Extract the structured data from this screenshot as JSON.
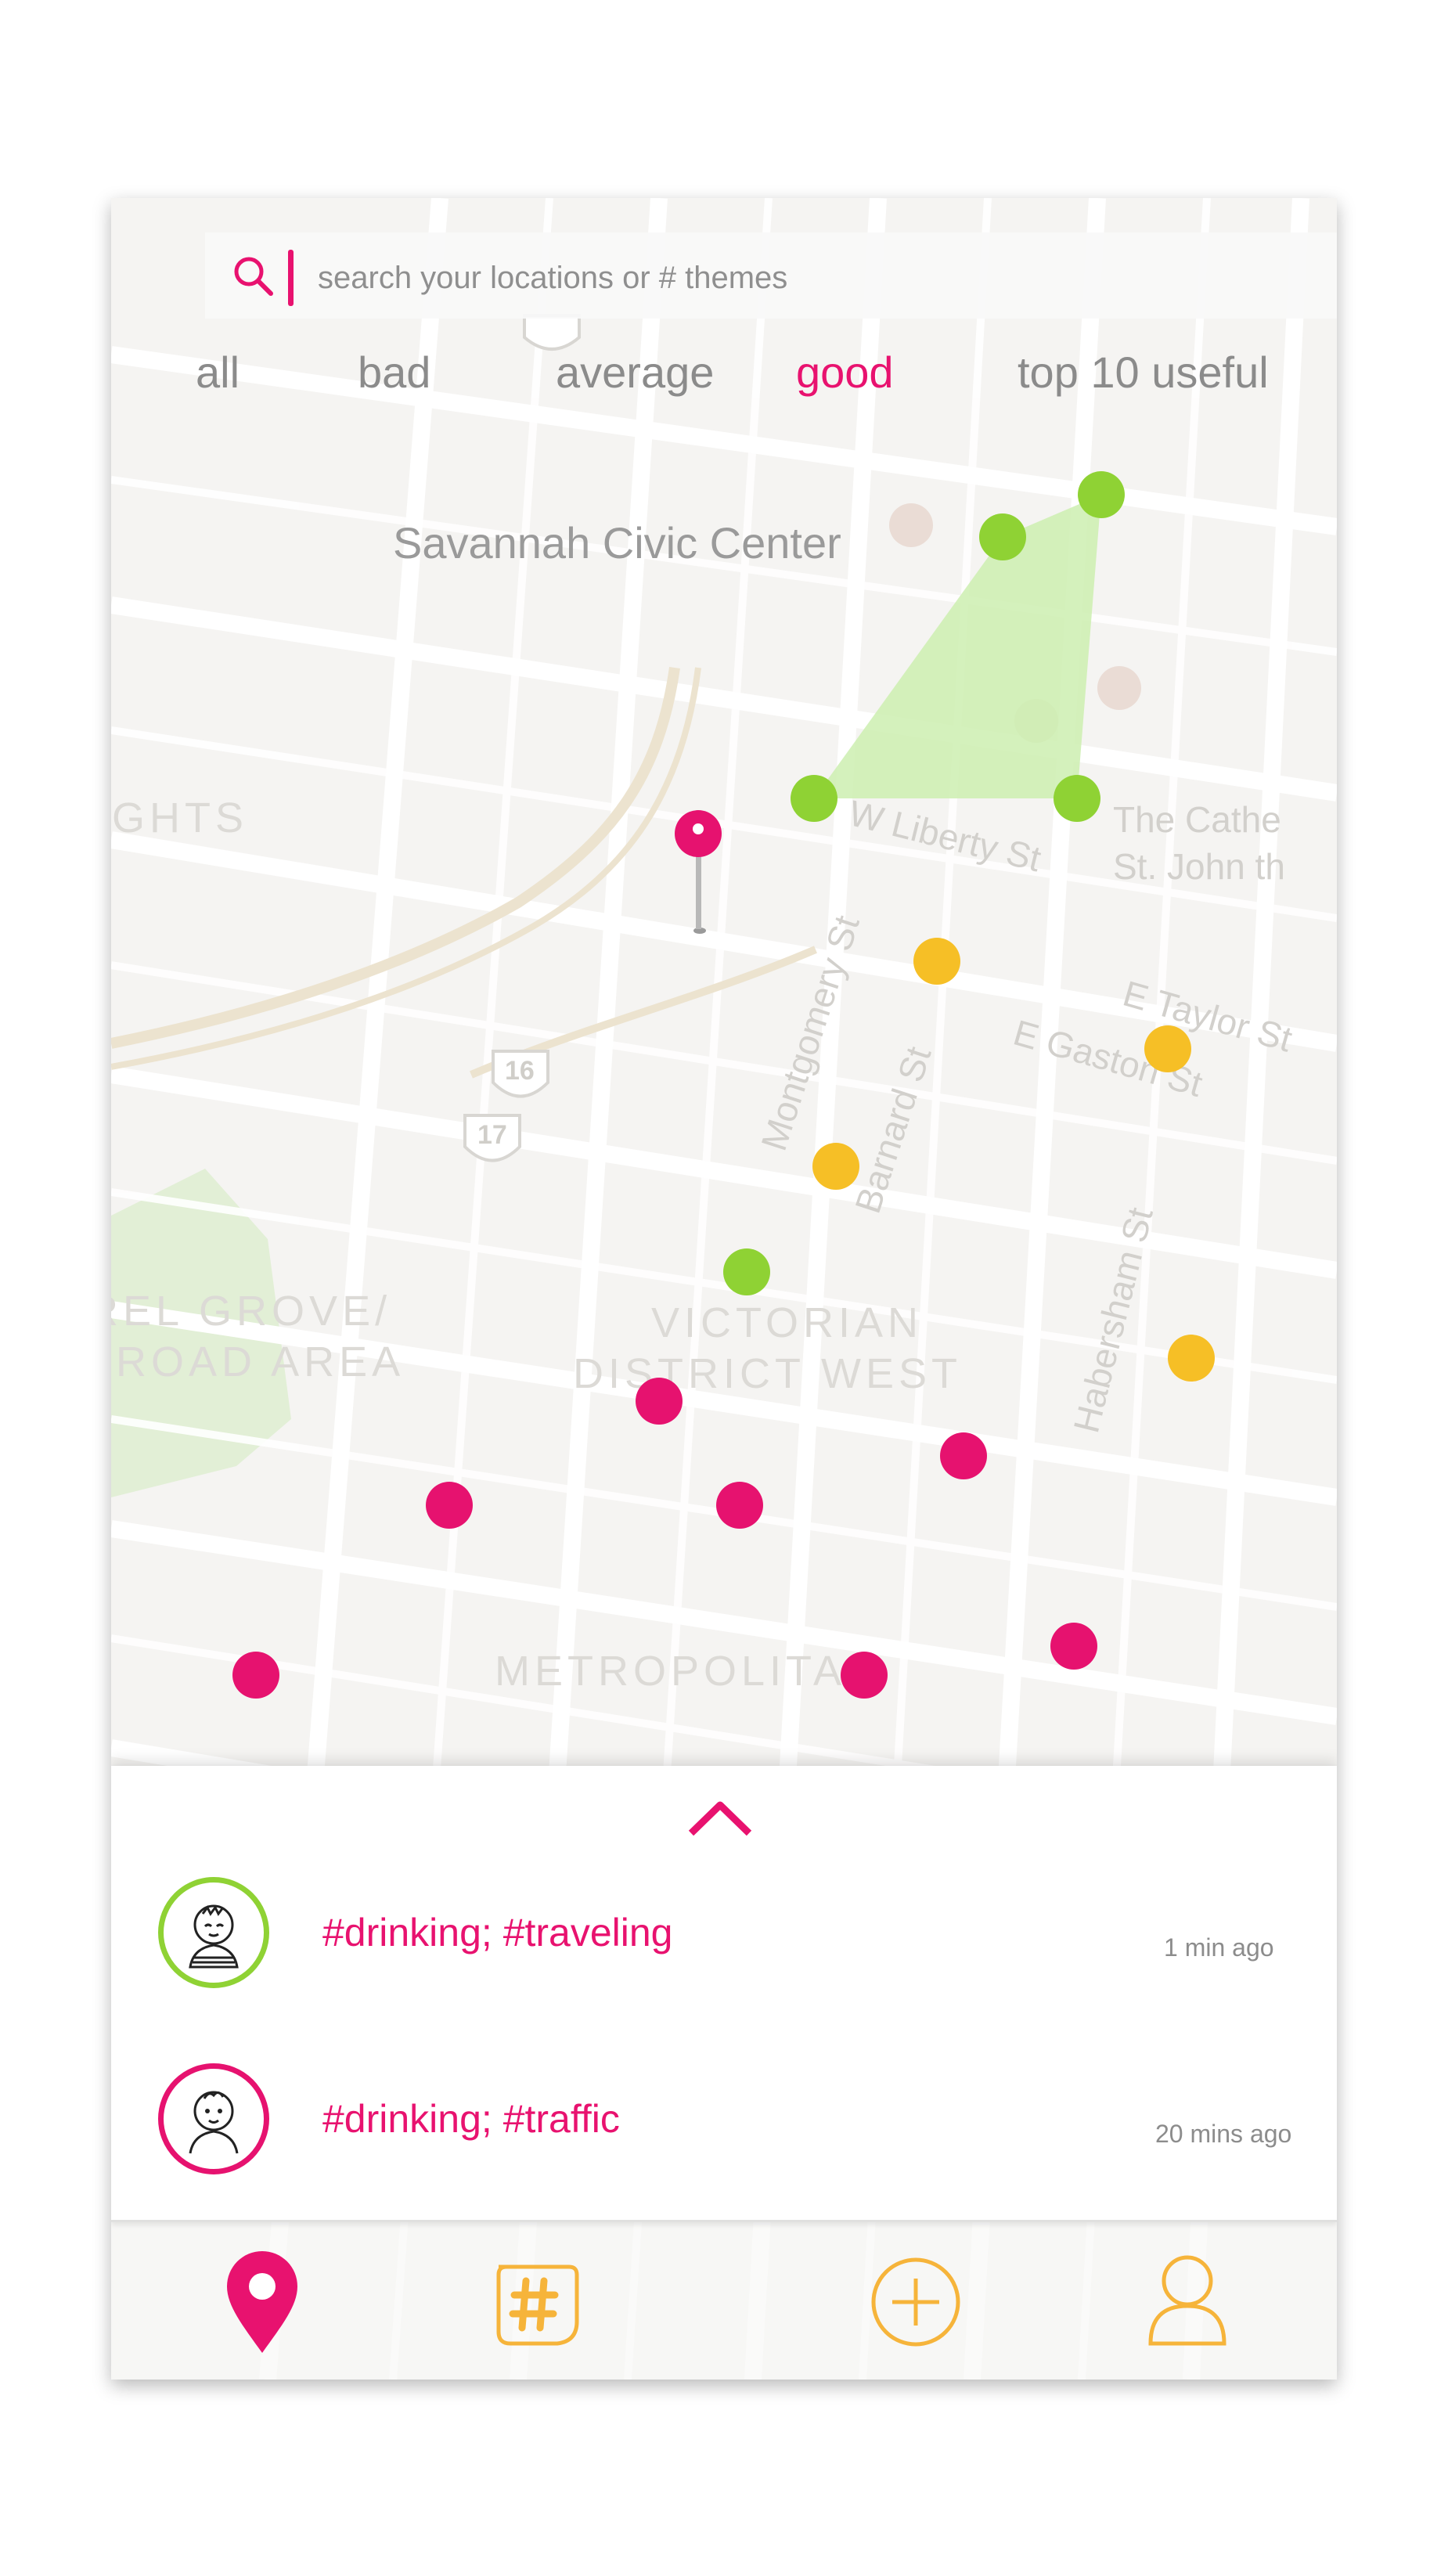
{
  "search": {
    "placeholder": "search your locations or # themes"
  },
  "filters": {
    "tabs": [
      {
        "label": "all",
        "active": false
      },
      {
        "label": "bad",
        "active": false
      },
      {
        "label": "average",
        "active": false
      },
      {
        "label": "good",
        "active": true
      },
      {
        "label": "top 10 useful",
        "active": false
      }
    ]
  },
  "map": {
    "poi_label": "Savannah Civic Center",
    "rating_colors": {
      "good": "#8fd234",
      "average": "#f6bf26",
      "bad": "#e6126f"
    },
    "area_color": "#cdeeb0"
  },
  "feed": {
    "items": [
      {
        "tags": "#drinking; #traveling",
        "time": "1 min ago",
        "ring_color": "#8fd234"
      },
      {
        "tags": "#drinking; #traffic",
        "time": "20 mins ago",
        "ring_color": "#e6126f"
      }
    ]
  },
  "tabbar": {
    "items": [
      {
        "icon": "map-pin-icon",
        "active": true
      },
      {
        "icon": "hashtag-chat-icon",
        "active": false
      },
      {
        "icon": "add-circle-icon",
        "active": false
      },
      {
        "icon": "user-profile-icon",
        "active": false
      }
    ],
    "active_color": "#e8126f",
    "inactive_color": "#f6b43a"
  },
  "brand": {
    "accent": "#e8126f"
  }
}
